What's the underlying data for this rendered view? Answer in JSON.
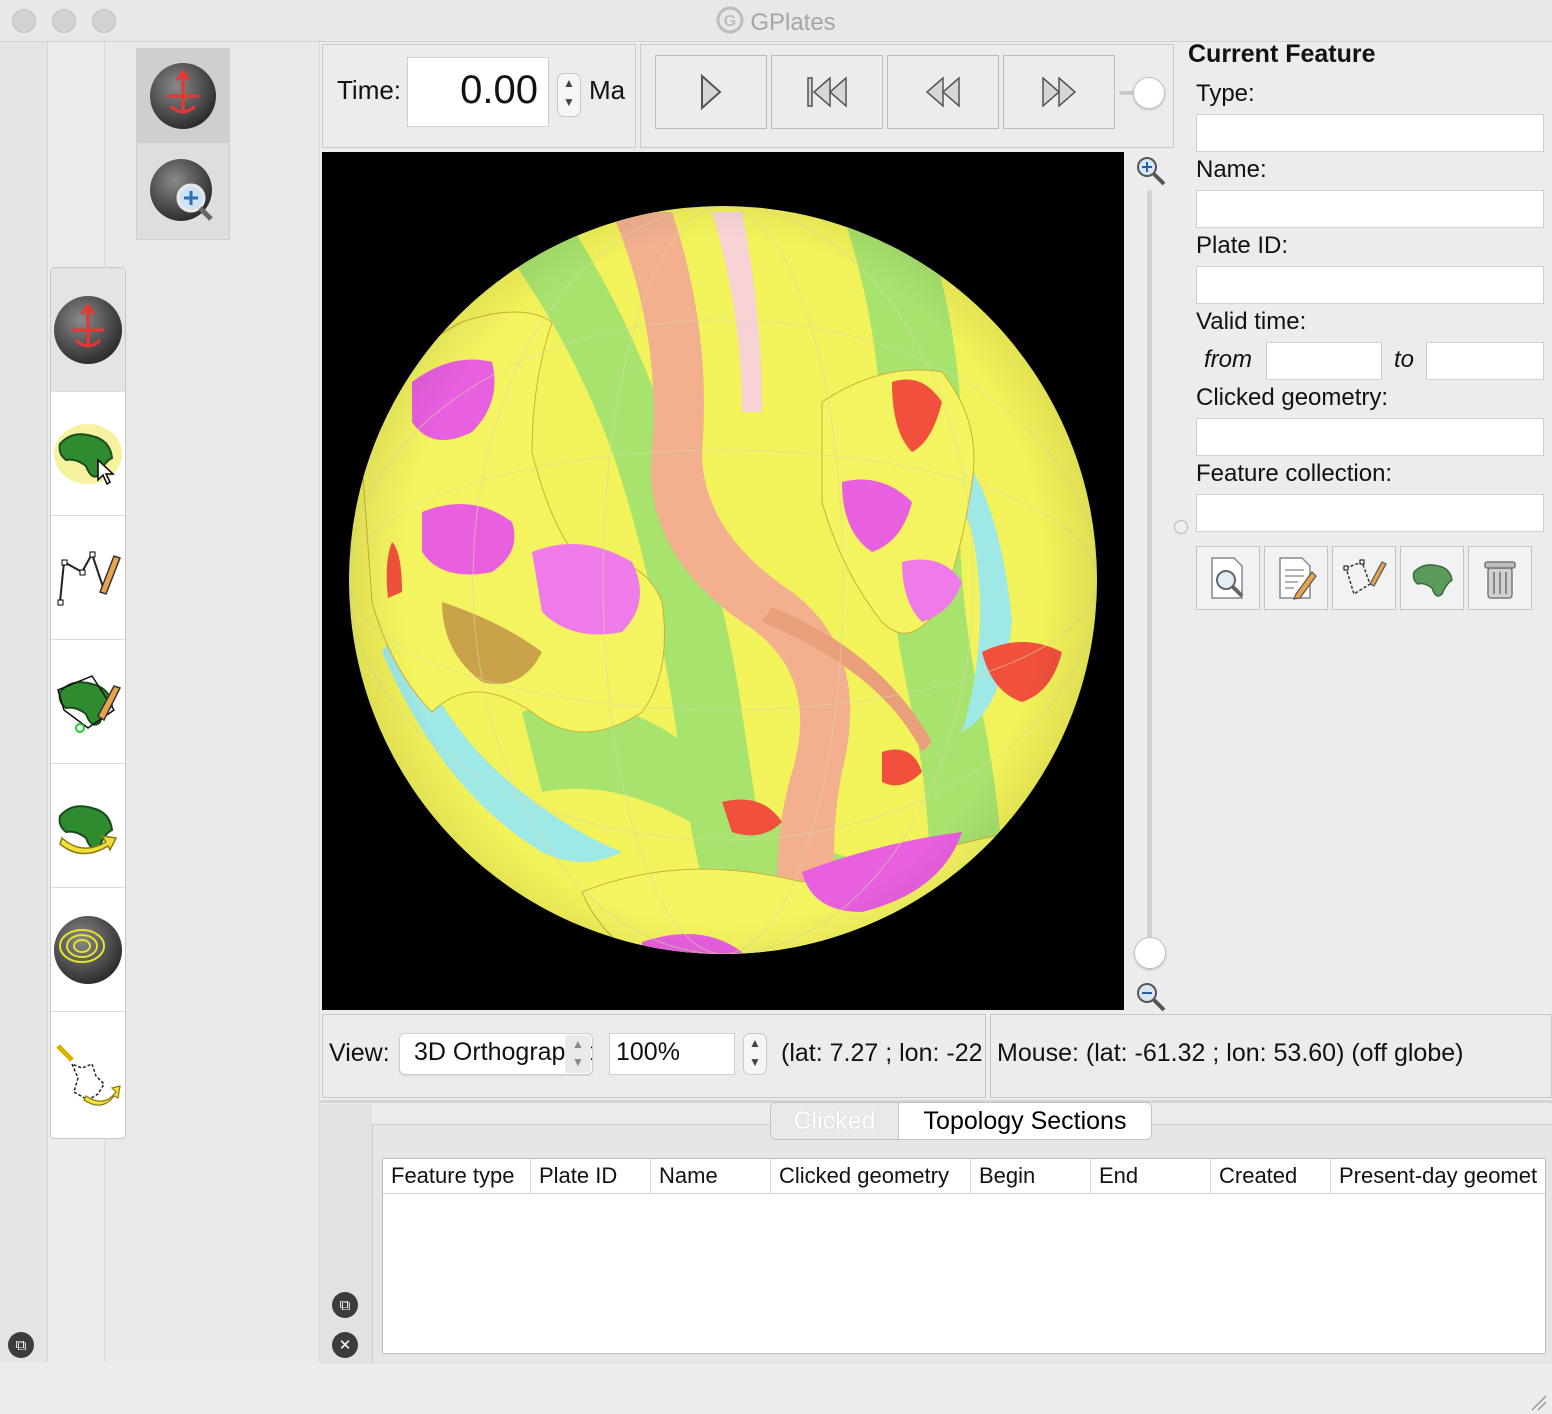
{
  "window": {
    "title": "GPlates"
  },
  "time": {
    "label": "Time:",
    "value": "0.00",
    "unit": "Ma"
  },
  "animation": {
    "buttons": [
      {
        "name": "play",
        "icon": "play-icon"
      },
      {
        "name": "reset",
        "icon": "skip-to-start-icon"
      },
      {
        "name": "step-back",
        "icon": "step-back-icon"
      },
      {
        "name": "step-forward",
        "icon": "step-forward-icon"
      }
    ]
  },
  "view_tools": [
    "drag-globe-icon",
    "zoom-globe-icon"
  ],
  "main_tools": [
    "drag-globe-icon",
    "choose-feature-icon",
    "digitise-geometry-icon",
    "edit-feature-geometry-icon",
    "move-feature-icon",
    "small-circle-icon",
    "build-topology-icon"
  ],
  "current_feature": {
    "title": "Current Feature",
    "type_label": "Type:",
    "name_label": "Name:",
    "plate_id_label": "Plate ID:",
    "valid_time_label": "Valid time:",
    "from_label": "from",
    "to_label": "to",
    "clicked_geometry_label": "Clicked geometry:",
    "feature_collection_label": "Feature collection:",
    "action_icons": [
      "query-feature-icon",
      "edit-feature-icon",
      "edit-geometry-icon",
      "reconstruction-pole-icon",
      "delete-feature-icon"
    ]
  },
  "view_bar": {
    "label": "View:",
    "projection": "3D Orthographic",
    "zoom": "100%",
    "camera_coords": "(lat: 7.27 ; lon: -22",
    "mouse_coords": "Mouse: (lat: -61.32 ; lon: 53.60) (off globe)"
  },
  "tabs": {
    "clicked": "Clicked",
    "topology_sections": "Topology Sections"
  },
  "table": {
    "columns": [
      "Feature type",
      "Plate ID",
      "Name",
      "Clicked geometry",
      "Begin",
      "End",
      "Created",
      "Present-day geomet"
    ]
  },
  "colors": {
    "globe_background": "#000000",
    "ocean_floor_yellow": "#f2f25a",
    "ocean_floor_green": "#a7e36d",
    "ridge_salmon": "#f2b08f",
    "craton_magenta": "#e85fe0",
    "hotspot_red": "#f0503c",
    "shelf_cyan": "#9ee8e6"
  }
}
